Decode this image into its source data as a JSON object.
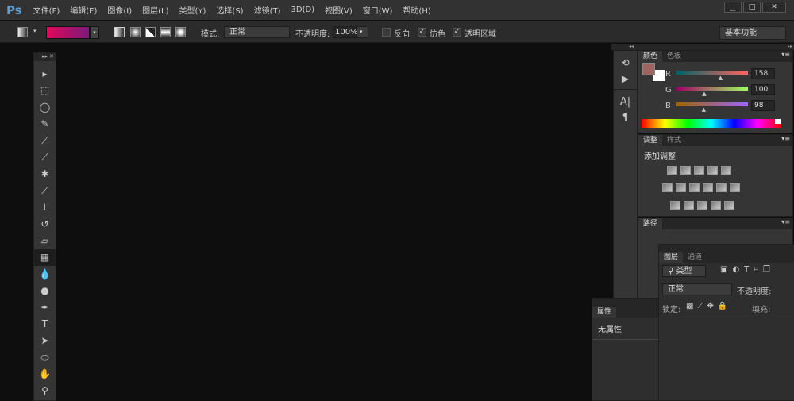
{
  "app": {
    "logo": "Ps"
  },
  "menu": [
    "文件(F)",
    "编辑(E)",
    "图像(I)",
    "图层(L)",
    "类型(Y)",
    "选择(S)",
    "滤镜(T)",
    "3D(D)",
    "视图(V)",
    "窗口(W)",
    "帮助(H)"
  ],
  "window_controls": {
    "minimize": "▁",
    "maximize": "□",
    "close": "✕"
  },
  "options": {
    "mode_label": "模式:",
    "mode_value": "正常",
    "opacity_label": "不透明度:",
    "opacity_value": "100%",
    "reverse": "反向",
    "reverse_checked": false,
    "dither": "仿色",
    "dither_checked": true,
    "transparency": "透明区域",
    "transparency_checked": true,
    "workspace": "基本功能",
    "gradient_colors": [
      "#e0085a",
      "#7a1a7a"
    ]
  },
  "tools": [
    "move",
    "marquee",
    "lasso",
    "quick-select",
    "crop",
    "eyedropper",
    "healing",
    "brush",
    "stamp",
    "history-brush",
    "eraser",
    "gradient",
    "blur",
    "dodge",
    "pen",
    "type",
    "path-select",
    "ellipse",
    "hand",
    "zoom"
  ],
  "tool_glyphs": [
    "▸",
    "⬚",
    "◯",
    "✎",
    "⟋",
    "⟋",
    "✱",
    "⟋",
    "⊥",
    "↺",
    "▱",
    "▦",
    "💧",
    "●",
    "✒",
    "T",
    "➤",
    "⬭",
    "✋",
    "⚲"
  ],
  "color_panel": {
    "tabs": [
      "颜色",
      "色板"
    ],
    "r_label": "R",
    "g_label": "G",
    "b_label": "B",
    "r": 158,
    "g": 100,
    "b": 98,
    "foreground": "#9e6462",
    "background": "#ffffff"
  },
  "adjust_panel": {
    "tabs": [
      "调整",
      "样式"
    ],
    "title": "添加调整"
  },
  "paths_panel": {
    "tab": "路径"
  },
  "layers_panel": {
    "tabs": [
      "图层",
      "通道"
    ],
    "filter": "类型",
    "blend": "正常",
    "opacity_label": "不透明度:",
    "lock_label": "锁定:",
    "fill_label": "填充:"
  },
  "properties_panel": {
    "tab": "属性",
    "empty": "无属性"
  }
}
